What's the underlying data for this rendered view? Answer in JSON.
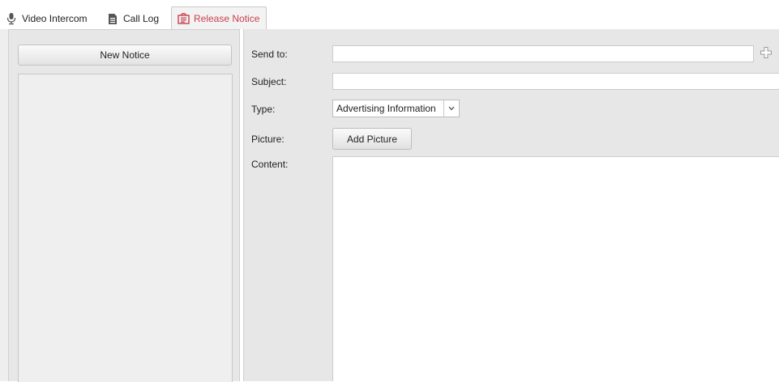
{
  "tabs": [
    {
      "label": "Video Intercom",
      "icon": "microphone-icon",
      "active": false
    },
    {
      "label": "Call Log",
      "icon": "document-icon",
      "active": false
    },
    {
      "label": "Release Notice",
      "icon": "notice-icon",
      "active": true
    }
  ],
  "left": {
    "new_notice_label": "New Notice"
  },
  "form": {
    "send_to_label": "Send to:",
    "send_to_value": "",
    "subject_label": "Subject:",
    "subject_value": "",
    "type_label": "Type:",
    "type_value": "Advertising Information",
    "picture_label": "Picture:",
    "add_picture_label": "Add Picture",
    "content_label": "Content:",
    "content_value": ""
  },
  "colors": {
    "active_tab_text": "#c8404d",
    "panel_bg": "#e7e7e7"
  }
}
